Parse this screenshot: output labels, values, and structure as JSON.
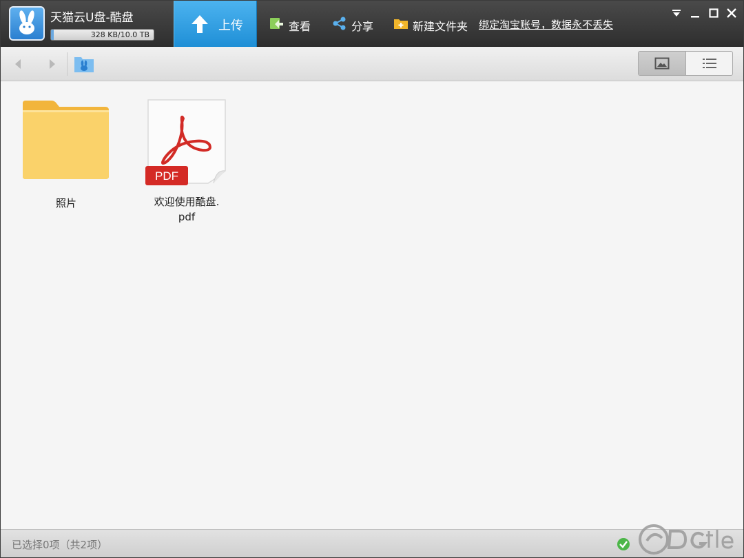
{
  "app": {
    "title": "天猫云U盘-酷盘",
    "quota_text": "328 KB/10.0 TB",
    "quota_fraction": 0.03
  },
  "toolbar": {
    "upload_label": "上传",
    "view_label": "查看",
    "share_label": "分享",
    "new_folder_label": "新建文件夹",
    "bind_link": "绑定淘宝账号，数据永不丢失"
  },
  "window_controls": {
    "menu_icon": "dropdown-menu-icon",
    "minimize": "minimize-icon",
    "maximize": "maximize-icon",
    "close": "close-icon"
  },
  "navigation": {
    "back_icon": "back-arrow-icon",
    "forward_icon": "forward-arrow-icon",
    "location_icon": "root-folder-rabbit-icon",
    "view_modes": [
      "thumbnail-view",
      "list-view"
    ],
    "active_view": "thumbnail-view"
  },
  "files": [
    {
      "name": "照片",
      "type": "folder"
    },
    {
      "name_line1": "欢迎使用酷盘.",
      "name_line2": "pdf",
      "type": "pdf",
      "badge": "PDF"
    }
  ],
  "status": {
    "selection_text": "已选择0项（共2项）"
  },
  "colors": {
    "titlebar": "#3a3a3a",
    "upload_accent": "#2b9be0",
    "folder": "#f7c34d",
    "pdf_red": "#d42a25"
  }
}
